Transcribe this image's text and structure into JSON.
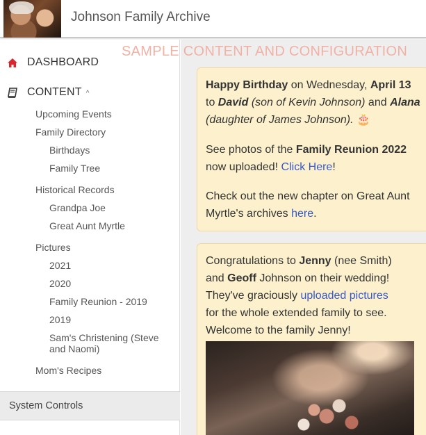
{
  "header": {
    "title": "Johnson Family Archive",
    "logo": "family-photo-logo"
  },
  "banner": "SAMPLE CONTENT AND CONFIGURATION",
  "sidebar": {
    "dashboard": "DASHBOARD",
    "content": "CONTENT",
    "items": {
      "upcoming_events": "Upcoming Events",
      "family_directory": "Family Directory",
      "birthdays": "Birthdays",
      "family_tree": "Family Tree",
      "historical_records": "Historical Records",
      "grandpa_joe": "Grandpa Joe",
      "great_aunt_myrtle": "Great Aunt Myrtle",
      "pictures": "Pictures",
      "y2021": "2021",
      "y2020": "2020",
      "family_reunion_2019": "Family Reunion - 2019",
      "y2019": "2019",
      "christening_line1": "Sam's Christening (Steve",
      "christening_line2": "and Naomi)",
      "moms_recipes": "Mom's Recipes"
    },
    "system_controls": "System Controls",
    "icons": {
      "dashboard": "home-icon",
      "content": "book-icon",
      "expand": "chevron-up-icon"
    },
    "accent_color": "#d9262f"
  },
  "card1": {
    "p1": {
      "a": "Happy Birthday",
      "b": " on Wednesday, ",
      "c": "April 13",
      "d": "to ",
      "e": "David",
      "f": " (son of Kevin Johnson)",
      "g": " and ",
      "h": "Alana",
      "i": "(daughter of James Johnson).",
      "cake": "🎂"
    },
    "p2": {
      "a": "See photos of the ",
      "b": "Family Reunion 2022",
      "c": "now uploaded! ",
      "link": "Click Here",
      "d": "!"
    },
    "p3": {
      "a": "Check out the new chapter on Great Aunt",
      "b": "Myrtle's archives ",
      "link": "here",
      "c": "."
    }
  },
  "card2": {
    "a": "Congratulations to ",
    "b": "Jenny",
    "c": " (nee Smith)",
    "d": "and ",
    "e": "Geoff",
    "f": " Johnson on their wedding!",
    "g": "They've graciously ",
    "link": "uploaded pictures",
    "h": "for the whole extended family to see.",
    "i": "Welcome to the family Jenny!",
    "photo": "wedding-bouquet-photo"
  }
}
